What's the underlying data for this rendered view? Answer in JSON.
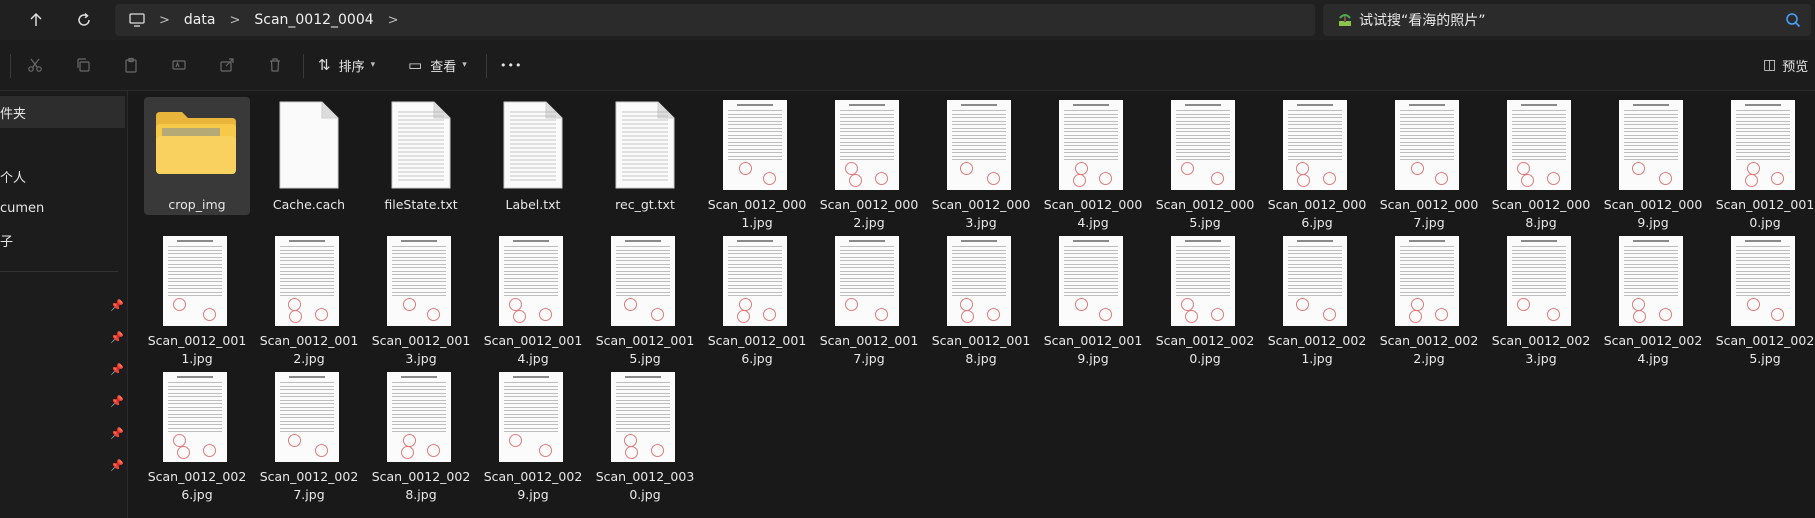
{
  "window": {
    "address": {
      "segments": [
        "data",
        "Scan_0012_0004"
      ]
    },
    "search": {
      "placeholder": "试试搜“看海的照片”"
    }
  },
  "toolbar": {
    "sort_label": "排序",
    "view_label": "查看",
    "more_label": "•••",
    "preview_label": "预览"
  },
  "sidebar": {
    "items": [
      {
        "label": "件夹",
        "selected": true
      },
      {
        "label": "个人",
        "selected": false
      },
      {
        "label": "cumen",
        "selected": false
      },
      {
        "label": "子",
        "selected": false
      }
    ]
  },
  "files": [
    {
      "name": "crop_img",
      "type": "folder",
      "selected": true
    },
    {
      "name": "Cache.cach",
      "type": "blank"
    },
    {
      "name": "fileState.txt",
      "type": "text"
    },
    {
      "name": "Label.txt",
      "type": "text"
    },
    {
      "name": "rec_gt.txt",
      "type": "text"
    },
    {
      "name": "Scan_0012_0001.jpg",
      "type": "image"
    },
    {
      "name": "Scan_0012_0002.jpg",
      "type": "image"
    },
    {
      "name": "Scan_0012_0003.jpg",
      "type": "image"
    },
    {
      "name": "Scan_0012_0004.jpg",
      "type": "image"
    },
    {
      "name": "Scan_0012_0005.jpg",
      "type": "image"
    },
    {
      "name": "Scan_0012_0006.jpg",
      "type": "image"
    },
    {
      "name": "Scan_0012_0007.jpg",
      "type": "image"
    },
    {
      "name": "Scan_0012_0008.jpg",
      "type": "image"
    },
    {
      "name": "Scan_0012_0009.jpg",
      "type": "image"
    },
    {
      "name": "Scan_0012_0010.jpg",
      "type": "image"
    },
    {
      "name": "Scan_0012_0011.jpg",
      "type": "image"
    },
    {
      "name": "Scan_0012_0012.jpg",
      "type": "image"
    },
    {
      "name": "Scan_0012_0013.jpg",
      "type": "image"
    },
    {
      "name": "Scan_0012_0014.jpg",
      "type": "image"
    },
    {
      "name": "Scan_0012_0015.jpg",
      "type": "image"
    },
    {
      "name": "Scan_0012_0016.jpg",
      "type": "image"
    },
    {
      "name": "Scan_0012_0017.jpg",
      "type": "image"
    },
    {
      "name": "Scan_0012_0018.jpg",
      "type": "image"
    },
    {
      "name": "Scan_0012_0019.jpg",
      "type": "image"
    },
    {
      "name": "Scan_0012_0020.jpg",
      "type": "image"
    },
    {
      "name": "Scan_0012_0021.jpg",
      "type": "image"
    },
    {
      "name": "Scan_0012_0022.jpg",
      "type": "image"
    },
    {
      "name": "Scan_0012_0023.jpg",
      "type": "image"
    },
    {
      "name": "Scan_0012_0024.jpg",
      "type": "image"
    },
    {
      "name": "Scan_0012_0025.jpg",
      "type": "image"
    },
    {
      "name": "Scan_0012_0026.jpg",
      "type": "image"
    },
    {
      "name": "Scan_0012_0027.jpg",
      "type": "image"
    },
    {
      "name": "Scan_0012_0028.jpg",
      "type": "image"
    },
    {
      "name": "Scan_0012_0029.jpg",
      "type": "image"
    },
    {
      "name": "Scan_0012_0030.jpg",
      "type": "image"
    }
  ],
  "colors": {
    "background": "#191919",
    "selection": "#393939",
    "folder_yellow": "#f7c948",
    "stamp_red": "#e07a7a",
    "accent_blue": "#4aa3ff"
  }
}
